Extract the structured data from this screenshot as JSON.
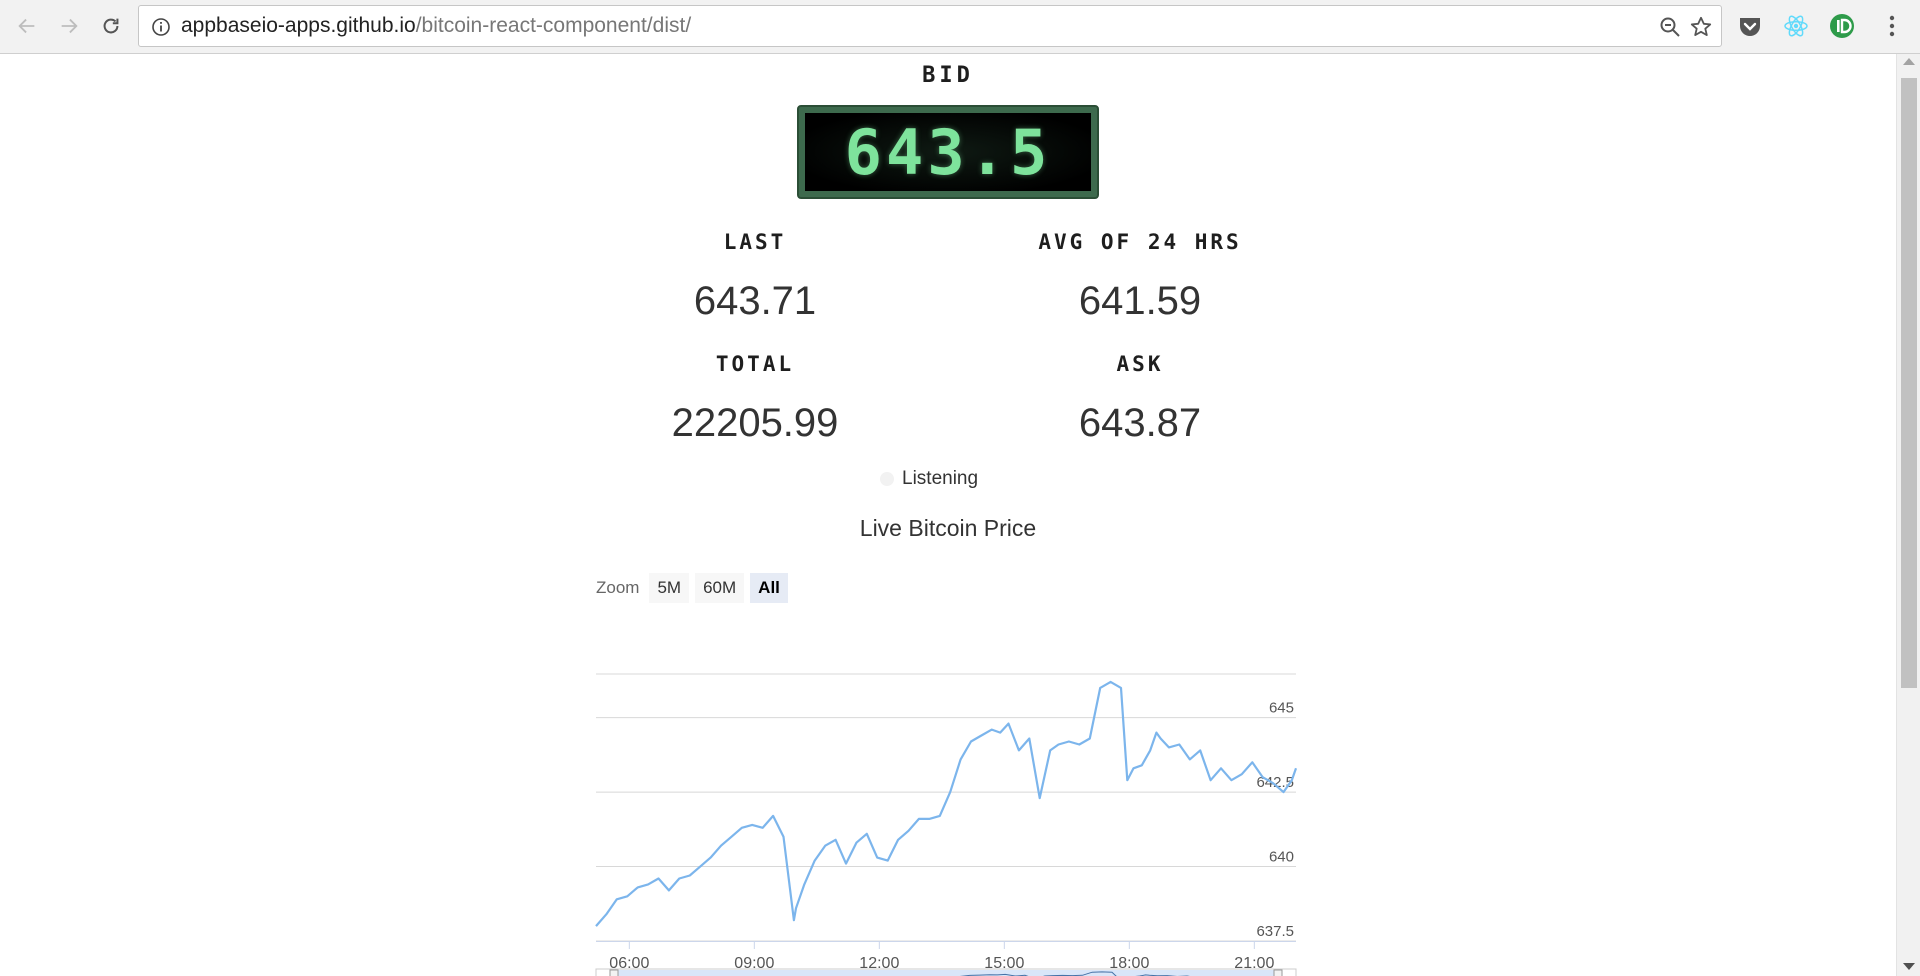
{
  "browser": {
    "url_host": "appbaseio-apps.github.io",
    "url_path": "/bitcoin-react-component/dist/"
  },
  "ticker": {
    "bid_label": "BID",
    "bid_value": "643.5",
    "last_label": "LAST",
    "last_value": "643.71",
    "avg_label": "AVG OF 24 HRS",
    "avg_value": "641.59",
    "total_label": "TOTAL",
    "total_value": "22205.99",
    "ask_label": "ASK",
    "ask_value": "643.87",
    "status": "Listening"
  },
  "colors": {
    "line": "#7cb5ec",
    "grid": "#d8d8d8",
    "bid_text": "#7ee39c",
    "navigator_fill": "#cfe0f7"
  },
  "zoom": {
    "label": "Zoom",
    "buttons": [
      "5M",
      "60M",
      "All"
    ],
    "active": "All"
  },
  "chart_data": {
    "type": "line",
    "title": "Live Bitcoin Price",
    "xlabel": "",
    "ylabel": "",
    "x_ticks": [
      "06:00",
      "09:00",
      "12:00",
      "15:00",
      "18:00",
      "21:00"
    ],
    "y_ticks": [
      637.5,
      640,
      642.5,
      645
    ],
    "xlim": [
      5.2,
      22.0
    ],
    "ylim": [
      637.5,
      646.5
    ],
    "grid": true,
    "series": [
      {
        "x": [
          5.2,
          5.45,
          5.7,
          5.95,
          6.2,
          6.45,
          6.7,
          6.95,
          7.2,
          7.45,
          7.7,
          7.95,
          8.2,
          8.45,
          8.7,
          8.95,
          9.2,
          9.45,
          9.7,
          9.95,
          10.0,
          10.2,
          10.45,
          10.7,
          10.95,
          11.2,
          11.45,
          11.7,
          11.95,
          12.2,
          12.45,
          12.7,
          12.95,
          13.2,
          13.45,
          13.7,
          13.95,
          14.2,
          14.45,
          14.7,
          14.9,
          15.1,
          15.35,
          15.6,
          15.85,
          16.1,
          16.3,
          16.55,
          16.8,
          17.05,
          17.3,
          17.55,
          17.8,
          17.95,
          18.1,
          18.3,
          18.5,
          18.65,
          18.75,
          18.95,
          19.2,
          19.45,
          19.7,
          19.95,
          20.2,
          20.45,
          20.7,
          20.95,
          21.2,
          21.45,
          21.7,
          21.9,
          22.0
        ],
        "values": [
          638.0,
          638.4,
          638.9,
          639.0,
          639.3,
          639.4,
          639.6,
          639.2,
          639.6,
          639.7,
          640.0,
          640.3,
          640.7,
          641.0,
          641.3,
          641.4,
          641.3,
          641.7,
          641.0,
          638.2,
          638.6,
          639.4,
          640.2,
          640.7,
          640.9,
          640.1,
          640.8,
          641.1,
          640.3,
          640.2,
          640.9,
          641.2,
          641.6,
          641.6,
          641.7,
          642.5,
          643.6,
          644.2,
          644.4,
          644.6,
          644.5,
          644.8,
          643.9,
          644.3,
          642.3,
          643.9,
          644.1,
          644.2,
          644.1,
          644.3,
          646.0,
          646.2,
          646.0,
          642.9,
          643.3,
          643.4,
          643.9,
          644.5,
          644.3,
          644.0,
          644.1,
          643.6,
          643.9,
          642.9,
          643.3,
          642.9,
          643.1,
          643.5,
          643.0,
          642.8,
          642.5,
          642.9,
          643.3
        ]
      }
    ]
  }
}
